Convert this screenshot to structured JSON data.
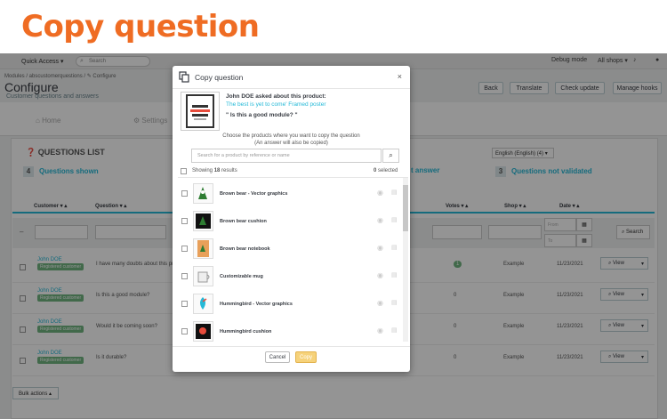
{
  "banner": {
    "title": "Copy question"
  },
  "topbar": {
    "quick_access": "Quick Access ▾",
    "search_placeholder": "Search",
    "debug": "Debug mode",
    "all_shops": "All shops ▾"
  },
  "page": {
    "breadcrumb": "Modules / abscustomerquestions / ✎ Configure",
    "title": "Configure",
    "subtitle": "Customer questions and answers",
    "buttons": [
      "Back",
      "Translate",
      "Check update",
      "Manage hooks"
    ]
  },
  "tabs": [
    "Home",
    "Settings"
  ],
  "panel": {
    "title": "QUESTIONS LIST",
    "language": "English (English) (4) ▾",
    "stats": [
      {
        "n": "4",
        "label": "Questions shown"
      },
      {
        "n": "",
        "label": "t answer"
      },
      {
        "n": "3",
        "label": "Questions not validated"
      }
    ],
    "columns": {
      "customer": "Customer ▾ ▴",
      "question": "Question ▾ ▴",
      "votes": "Votes ▾ ▴",
      "shop": "Shop ▾ ▴",
      "date": "Date ▾ ▴"
    },
    "filters": {
      "from": "From",
      "to": "To",
      "search": "Search"
    },
    "rows": [
      {
        "customer": "John DOE",
        "badge": "Registered customer",
        "question": "I have many doubts about this pro...",
        "votes": "1",
        "shop": "Example",
        "date": "11/23/2021"
      },
      {
        "customer": "John DOE",
        "badge": "Registered customer",
        "question": "Is this a good module?",
        "votes": "0",
        "shop": "Example",
        "date": "11/23/2021"
      },
      {
        "customer": "John DOE",
        "badge": "Registered customer",
        "question": "Would it be coming soon?",
        "votes": "0",
        "shop": "Example",
        "date": "11/23/2021"
      },
      {
        "customer": "John DOE",
        "badge": "Registered customer",
        "question": "Is it durable?",
        "votes": "0",
        "shop": "Example",
        "date": "11/23/2021"
      }
    ],
    "view_label": "View",
    "bulk": "Bulk actions ▴"
  },
  "modal": {
    "title": "Copy question",
    "ask_line": "John DOE asked about this product:",
    "product": "The best is yet to come' Framed poster",
    "question": "\" Is this a good module? \"",
    "choose": "Choose the products where you want to copy the question",
    "choose_note": "(An answer will also be copied)",
    "search_placeholder": "Search for a product by reference or name",
    "showing_prefix": "Showing ",
    "showing_count": "18",
    "showing_suffix": " results",
    "selected_count": "0",
    "selected_label": " selected",
    "products": [
      "Brown bear - Vector graphics",
      "Brown bear cushion",
      "Brown bear notebook",
      "Customizable mug",
      "Hummingbird - Vector graphics",
      "Hummingbird cushion"
    ],
    "cancel": "Cancel",
    "copy": "Copy"
  }
}
